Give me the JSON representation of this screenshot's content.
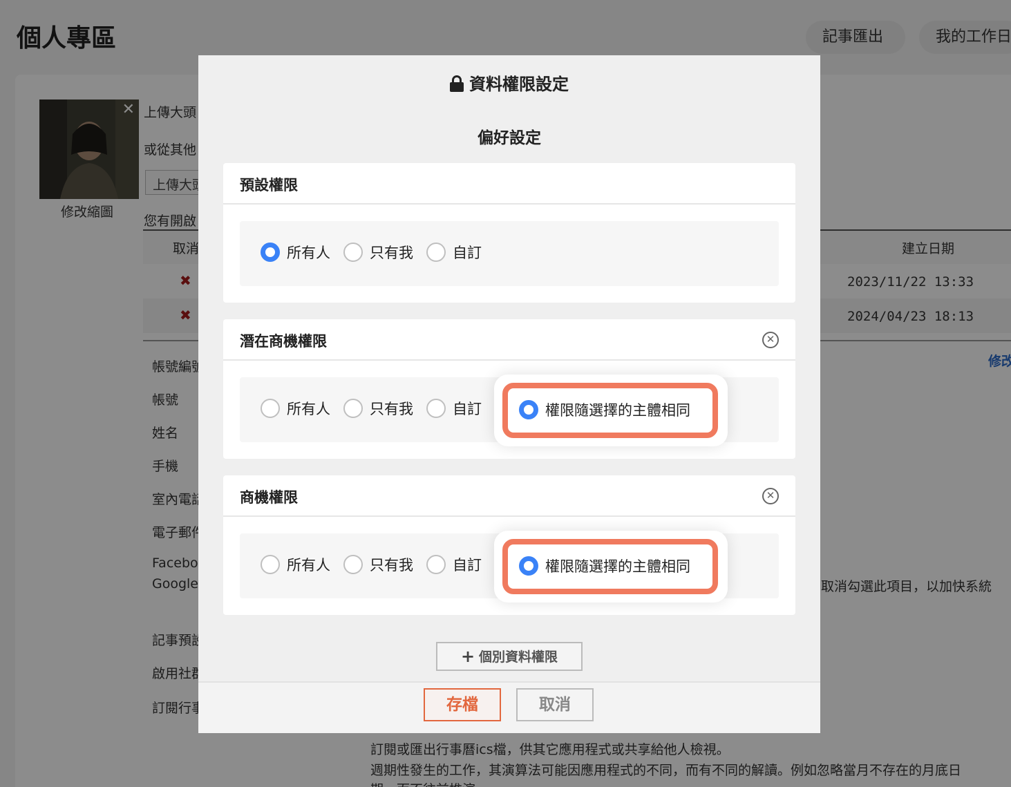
{
  "page": {
    "title": "個人專區",
    "top_buttons": [
      "記事匯出",
      "我的工作日"
    ],
    "avatar_close": "✕",
    "avatar_caption": "修改縮圖",
    "upload_text": "上傳大頭",
    "other_source_text": "或從其他",
    "upload_button": "上傳大頭",
    "enabled_text": "您有開啟",
    "cancel_col": "取消",
    "created_col": "建立日期",
    "rows": [
      {
        "del": "✖",
        "date": "2023/11/22 13:33"
      },
      {
        "del": "✖",
        "date": "2024/04/23 18:13"
      }
    ],
    "modify_link": "修改",
    "fields": [
      "帳號編號",
      "帳號",
      "姓名",
      "手機",
      "室內電話",
      "電子郵件",
      "Facebook",
      "Google",
      "記事預設",
      "啟用社群",
      "訂閱行事"
    ],
    "right_note": "取消勾選此項目，以加快系統",
    "bottom_lines": [
      "訂閱或匯出行事曆ics檔，供其它應用程式或共享給他人檢視。",
      "週期性發生的工作，其演算法可能因應用程式的不同，而有不同的解讀。例如忽略當月不存在的月底日",
      "期，而不往前推演。"
    ]
  },
  "modal": {
    "title": "資料權限設定",
    "subtitle": "偏好設定",
    "cards": [
      {
        "title": "預設權限",
        "options": [
          "所有人",
          "只有我",
          "自訂"
        ],
        "selected": "所有人"
      },
      {
        "title": "潛在商機權限",
        "options": [
          "所有人",
          "只有我",
          "自訂"
        ],
        "highlight_option": "權限隨選擇的主體相同",
        "selected": "權限隨選擇的主體相同"
      },
      {
        "title": "商機權限",
        "options": [
          "所有人",
          "只有我",
          "自訂"
        ],
        "highlight_option": "權限隨選擇的主體相同",
        "selected": "權限隨選擇的主體相同"
      }
    ],
    "close_icon": "✕",
    "add_button": "個別資料權限",
    "add_icon": "+",
    "save_button": "存檔",
    "cancel_button": "取消"
  },
  "colors": {
    "accent": "#3a82f7",
    "highlight": "#f07a5e",
    "save": "#e2673e",
    "danger": "#a51c1c"
  }
}
